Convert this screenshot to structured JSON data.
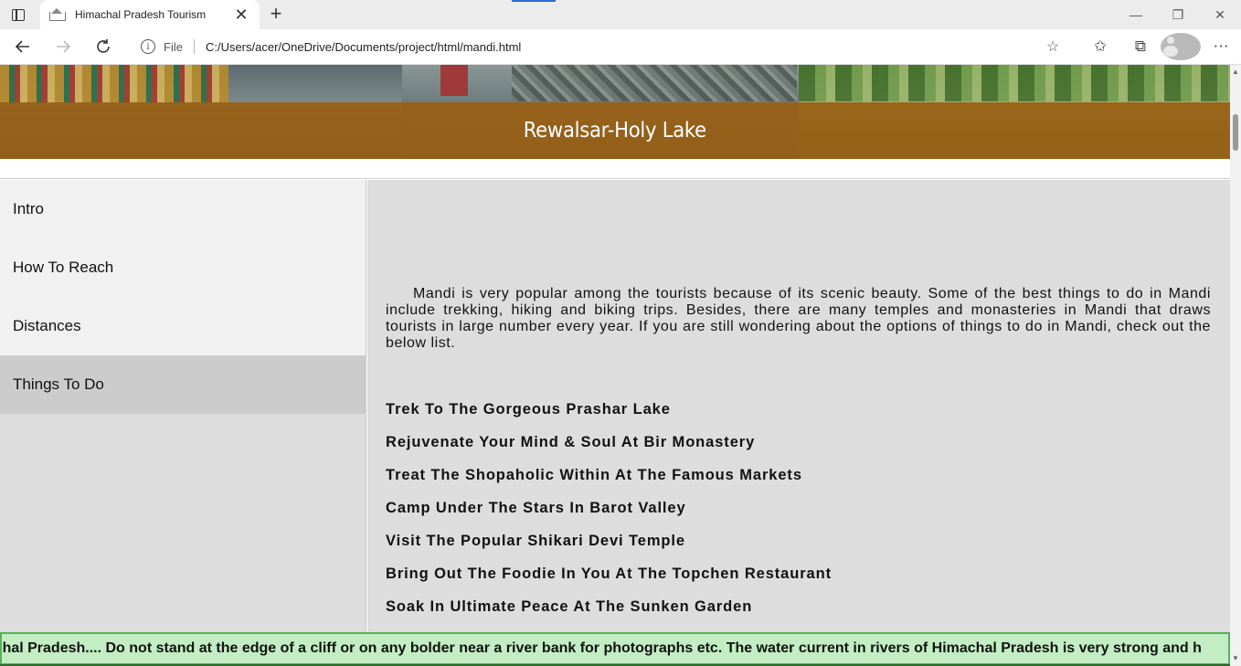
{
  "browser": {
    "tab_title": "Himachal Pradesh Tourism",
    "tab_close": "✕",
    "new_tab": "+",
    "address_scheme": "File",
    "address_url": "C:/Users/acer/OneDrive/Documents/project/html/mandi.html",
    "info_glyph": "i",
    "icons": {
      "back": "arrow-left-icon",
      "forward": "arrow-right-icon",
      "refresh": "refresh-icon",
      "favorites_add": "star-plus-icon",
      "favorites": "favorites-icon",
      "collections": "collections-icon",
      "profile": "avatar-icon",
      "menu": "more-icon",
      "minimize": "minimize-icon",
      "restore": "restore-icon",
      "close": "close-icon"
    }
  },
  "banner": {
    "caption": "Rewalsar-Holy Lake"
  },
  "sidebar": {
    "items": [
      {
        "label": "Intro"
      },
      {
        "label": "How To Reach"
      },
      {
        "label": "Distances"
      },
      {
        "label": "Things To Do",
        "active": true
      }
    ]
  },
  "main": {
    "intro": "Mandi is very popular among the tourists because of its scenic beauty. Some of the best things to do in Mandi include trekking, hiking and biking trips. Besides, there are many temples and monasteries in Mandi that draws tourists in large number every year. If you are still wondering about the options of things to do in Mandi, check out the below list.",
    "things_to_do": [
      "Trek To The Gorgeous Prashar Lake",
      "Rejuvenate Your Mind & Soul At Bir Monastery",
      "Treat The Shopaholic Within At The Famous Markets",
      "Camp Under The Stars In Barot Valley",
      "Visit The Popular Shikari Devi Temple",
      "Bring Out The Foodie In You At The Topchen Restaurant",
      "Soak In Ultimate Peace At The Sunken Garden"
    ]
  },
  "marquee": {
    "text": "nachal Pradesh.... Do not stand at the edge of a cliff or on any bolder near a river bank for photographs etc. The water current in rivers of Himachal Pradesh is very strong and h"
  },
  "colors": {
    "caption_band": "#996014",
    "marquee_bg": "#c3eec3",
    "marquee_border": "#55b355",
    "sidebar_active": "#cccccc",
    "content_bg": "#dddddd"
  }
}
